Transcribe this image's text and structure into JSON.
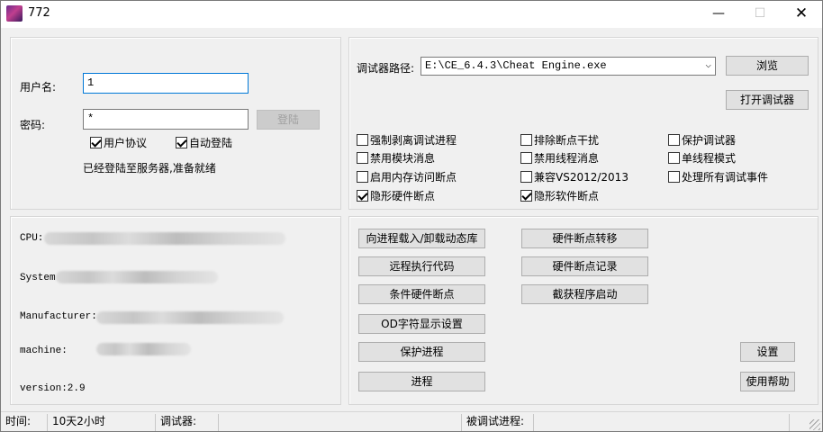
{
  "window": {
    "title": "772",
    "icon": "app-icon",
    "minimize_glyph": "—",
    "maximize_glyph": "☐",
    "close_glyph": "✕"
  },
  "login": {
    "username_label": "用户名:",
    "username_value": "1",
    "password_label": "密码:",
    "password_value": "*",
    "login_button": "登陆",
    "agreement_label": "用户协议",
    "agreement_checked": true,
    "autologin_label": "自动登陆",
    "autologin_checked": true,
    "status": "已经登陆至服务器,准备就绪"
  },
  "debugger": {
    "path_label": "调试器路径:",
    "path_value": "E:\\CE_6.4.3\\Cheat Engine.exe",
    "browse_button": "浏览",
    "open_button": "打开调试器",
    "options": [
      {
        "label": "强制剥离调试进程",
        "checked": false
      },
      {
        "label": "排除断点干扰",
        "checked": false
      },
      {
        "label": "保护调试器",
        "checked": false
      },
      {
        "label": "禁用模块消息",
        "checked": false
      },
      {
        "label": "禁用线程消息",
        "checked": false
      },
      {
        "label": "单线程模式",
        "checked": false
      },
      {
        "label": "启用内存访问断点",
        "checked": false
      },
      {
        "label": "兼容VS2012/2013",
        "checked": false
      },
      {
        "label": "处理所有调试事件",
        "checked": false
      },
      {
        "label": "隐形硬件断点",
        "checked": true
      },
      {
        "label": "隐形软件断点",
        "checked": true
      }
    ]
  },
  "sysinfo": {
    "cpu_label": "CPU:",
    "system_label": "System",
    "manufacturer_label": "Manufacturer:",
    "machine_label": "machine:",
    "version": "version:2.9"
  },
  "actions": {
    "inject_dll": "向进程载入/卸载动态库",
    "remote_exec": "远程执行代码",
    "cond_hw_bp": "条件硬件断点",
    "od_font": "OD字符显示设置",
    "protect_proc": "保护进程",
    "process": "进程",
    "hw_bp_transfer": "硬件断点转移",
    "hw_bp_record": "硬件断点记录",
    "intercept_start": "截获程序启动",
    "settings": "设置",
    "help": "使用帮助"
  },
  "statusbar": {
    "time_label": "时间:",
    "time_value": "10天2小时",
    "debugger_label": "调试器:",
    "debuggee_label": "被调试进程:"
  }
}
